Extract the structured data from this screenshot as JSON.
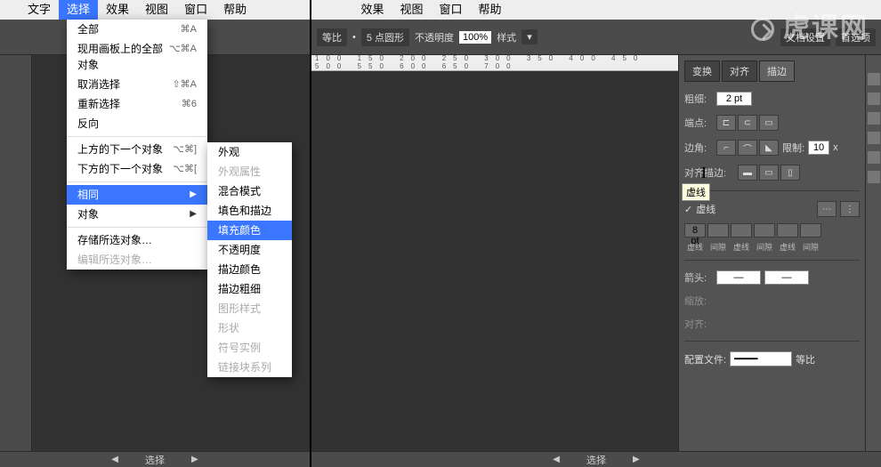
{
  "watermark": "虎课网",
  "menubar": {
    "items": [
      "文字",
      "选择",
      "效果",
      "视图",
      "窗口",
      "帮助"
    ],
    "active_index": 1
  },
  "dropdown": {
    "groups": [
      [
        {
          "label": "全部",
          "shortcut": "⌘A"
        },
        {
          "label": "现用画板上的全部对象",
          "shortcut": "⌥⌘A"
        },
        {
          "label": "取消选择",
          "shortcut": "⇧⌘A"
        },
        {
          "label": "重新选择",
          "shortcut": "⌘6"
        },
        {
          "label": "反向",
          "shortcut": ""
        }
      ],
      [
        {
          "label": "上方的下一个对象",
          "shortcut": "⌥⌘]"
        },
        {
          "label": "下方的下一个对象",
          "shortcut": "⌥⌘["
        }
      ],
      [
        {
          "label": "相同",
          "shortcut": "",
          "submenu": true,
          "selected": true
        },
        {
          "label": "对象",
          "shortcut": "",
          "submenu": true
        }
      ],
      [
        {
          "label": "存储所选对象…",
          "shortcut": ""
        },
        {
          "label": "编辑所选对象…",
          "shortcut": "",
          "disabled": true
        }
      ]
    ]
  },
  "submenu": {
    "items": [
      {
        "label": "外观"
      },
      {
        "label": "外观属性",
        "disabled": true
      },
      {
        "label": "混合模式"
      },
      {
        "label": "填色和描边"
      },
      {
        "label": "填充颜色",
        "selected": true
      },
      {
        "label": "不透明度"
      },
      {
        "label": "描边颜色"
      },
      {
        "label": "描边粗细"
      },
      {
        "label": "图形样式",
        "disabled": true
      },
      {
        "label": "形状",
        "disabled": true
      },
      {
        "label": "符号实例",
        "disabled": true
      },
      {
        "label": "链接块系列",
        "disabled": true
      }
    ]
  },
  "ctrlbar": {
    "opacity_label": "不透明度",
    "opacity_value": "100%",
    "style_label": "样式",
    "mode_label": "等比",
    "shape_label": "5 点圆形",
    "docset_label": "文档设置",
    "prefs_label": "首选项"
  },
  "status": {
    "label": "选择",
    "left_arrow": "◀",
    "right_arrow": "▶"
  },
  "right_panel": {
    "tabs": [
      "变换",
      "对齐",
      "描边"
    ],
    "active_tab": 2,
    "weight_label": "粗细:",
    "weight_value": "2 pt",
    "cap_label": "端点:",
    "corner_label": "边角:",
    "limit_label": "限制:",
    "limit_value": "10",
    "limit_unit": "x",
    "align_label": "对齐描边:",
    "dash_check": "虚线",
    "dash_value": "8 pt",
    "dash_labels": [
      "虚线",
      "间隙",
      "虚线",
      "间隙",
      "虚线",
      "间隙"
    ],
    "arrow_label": "箭头:",
    "scale_label": "缩放:",
    "align2_label": "对齐:",
    "profile_label": "配置文件:",
    "profile_value": "等比"
  },
  "tooltip": "虚线",
  "ruler_marks": "100  150  200  250  300  350  400  450  500  550  600  650  700"
}
